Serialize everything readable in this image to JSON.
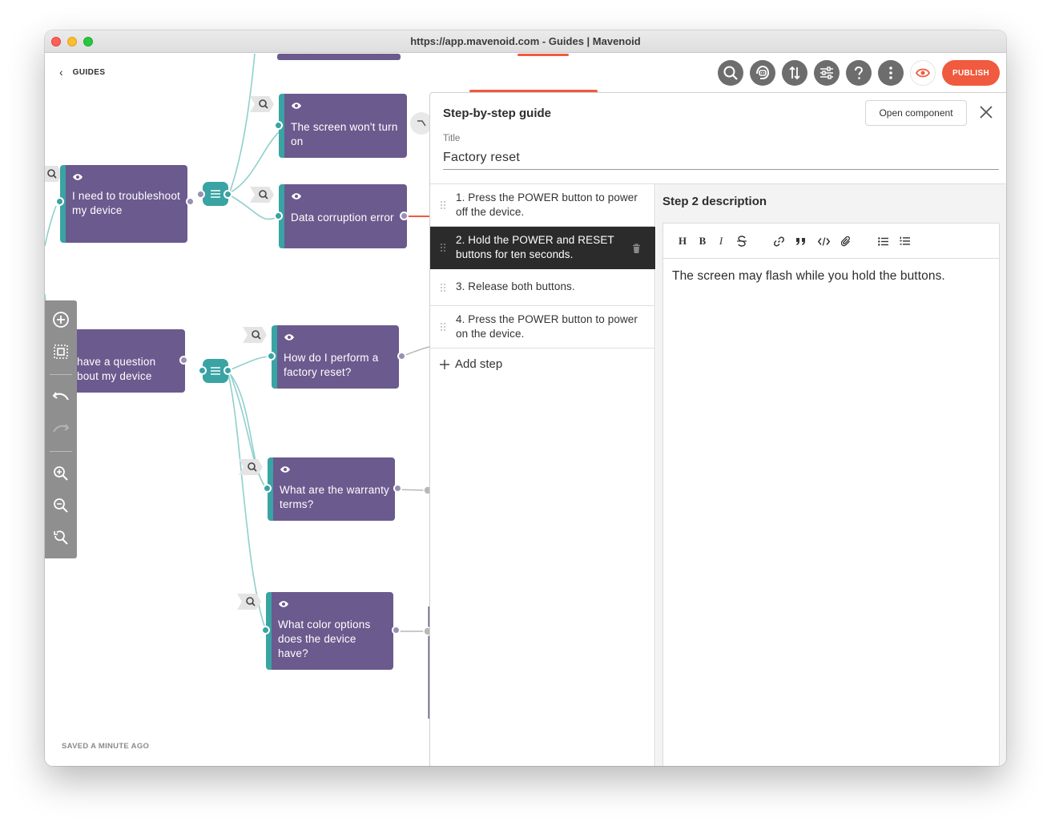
{
  "window": {
    "title": "https://app.mavenoid.com - Guides | Mavenoid"
  },
  "nav": {
    "back_label": "GUIDES"
  },
  "status": {
    "saved": "SAVED A MINUTE AGO"
  },
  "actions": {
    "publish": "PUBLISH",
    "icons": [
      "search-icon",
      "assistant-icon",
      "sort-icon",
      "sliders-icon",
      "help-icon",
      "more-icon",
      "preview-icon"
    ]
  },
  "flow": {
    "nodes": [
      {
        "text": "I need to troubleshoot my device"
      },
      {
        "text": "The screen won't turn on"
      },
      {
        "text": "Data corruption error"
      },
      {
        "text": "have a question bout my device"
      },
      {
        "text": "How do I perform a factory reset?"
      },
      {
        "text": "What are the warranty terms?"
      },
      {
        "text": "What color options does the device have?"
      }
    ]
  },
  "panel": {
    "title": "Step-by-step guide",
    "open_component": "Open component",
    "field_label": "Title",
    "field_value": "Factory reset",
    "steps": [
      {
        "text": "1. Press the POWER button to power off the device."
      },
      {
        "text": "2. Hold the POWER and RESET buttons for ten seconds."
      },
      {
        "text": "3. Release both buttons."
      },
      {
        "text": "4. Press the POWER button to power on the device."
      }
    ],
    "add_step": "Add step",
    "active_step": 2,
    "description_title": "Step 2 description",
    "description_body": "The screen may flash while you hold the buttons.",
    "editor_tools": {
      "heading": "H",
      "bold": "B",
      "italic": "I"
    }
  },
  "colors": {
    "node": "#6b5a8e",
    "accent": "#3aa3a3",
    "publish": "#f05a3e",
    "active_step": "#2b2b2b"
  }
}
